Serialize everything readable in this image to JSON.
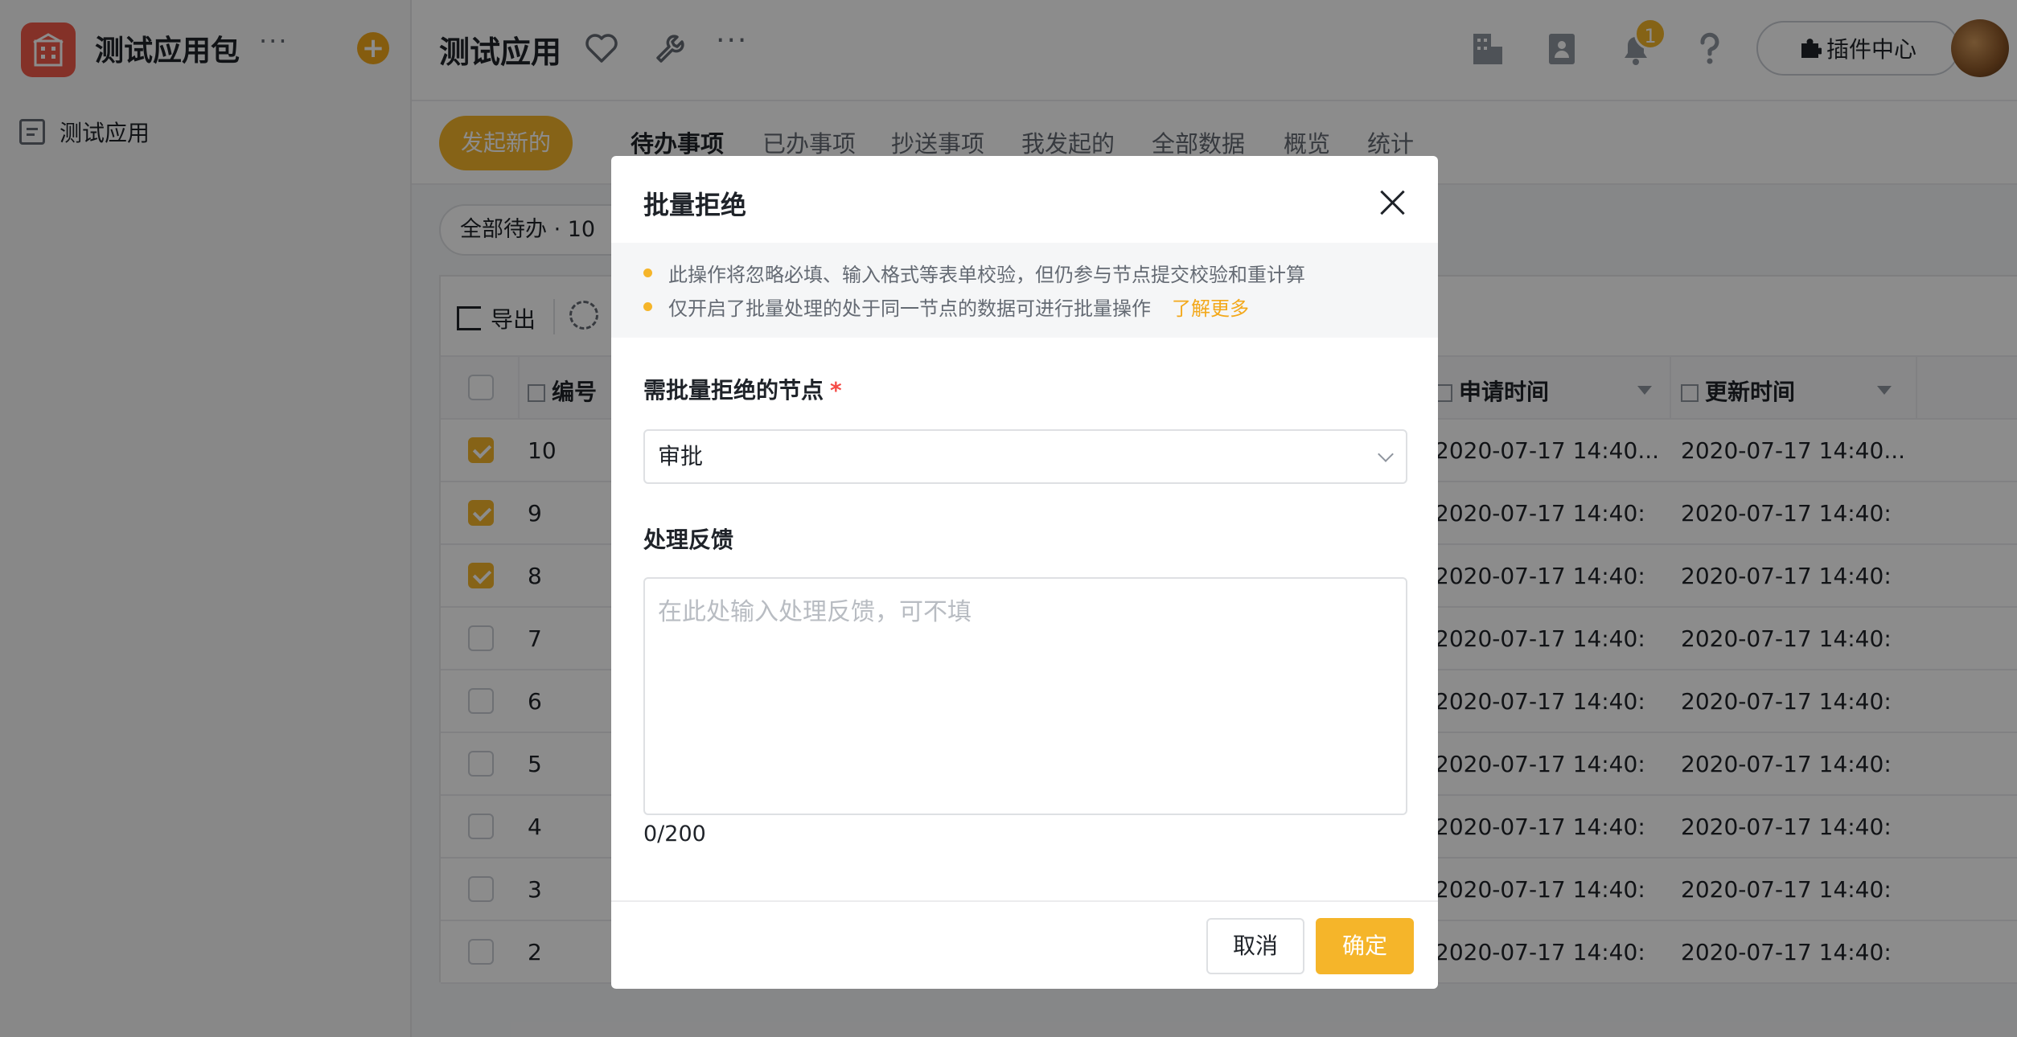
{
  "sidebar": {
    "app_name": "测试应用包",
    "more": "···",
    "add": "+",
    "items": [
      {
        "label": "测试应用"
      }
    ]
  },
  "topbar": {
    "title": "测试应用",
    "more": "···",
    "notification_count": "1",
    "plugin_center": "插件中心"
  },
  "subbar": {
    "new_button": "发起新的",
    "tabs": [
      {
        "label": "待办事项",
        "active": true
      },
      {
        "label": "已办事项"
      },
      {
        "label": "抄送事项"
      },
      {
        "label": "我发起的"
      },
      {
        "label": "全部数据"
      },
      {
        "label": "概览"
      },
      {
        "label": "统计"
      }
    ]
  },
  "content": {
    "filter": "全部待办 · 10",
    "toolbar": {
      "export": "导出"
    },
    "columns": {
      "number": "编号",
      "apply_time": "申请时间",
      "update_time": "更新时间"
    },
    "rows": [
      {
        "id": "10",
        "checked": true,
        "apply": "2020-07-17 14:40...",
        "update": "2020-07-17 14:40..."
      },
      {
        "id": "9",
        "checked": true,
        "apply": "2020-07-17 14:40:",
        "update": "2020-07-17 14:40:"
      },
      {
        "id": "8",
        "checked": true,
        "apply": "2020-07-17 14:40:",
        "update": "2020-07-17 14:40:"
      },
      {
        "id": "7",
        "checked": false,
        "apply": "2020-07-17 14:40:",
        "update": "2020-07-17 14:40:"
      },
      {
        "id": "6",
        "checked": false,
        "apply": "2020-07-17 14:40:",
        "update": "2020-07-17 14:40:"
      },
      {
        "id": "5",
        "checked": false,
        "apply": "2020-07-17 14:40:",
        "update": "2020-07-17 14:40:"
      },
      {
        "id": "4",
        "checked": false,
        "apply": "2020-07-17 14:40:",
        "update": "2020-07-17 14:40:"
      },
      {
        "id": "3",
        "checked": false,
        "apply": "2020-07-17 14:40:",
        "update": "2020-07-17 14:40:"
      },
      {
        "id": "2",
        "checked": false,
        "apply": "2020-07-17 14:40:",
        "update": "2020-07-17 14:40:"
      }
    ]
  },
  "modal": {
    "title": "批量拒绝",
    "notices": [
      "此操作将忽略必填、输入格式等表单校验，但仍参与节点提交校验和重计算",
      "仅开启了批量处理的处于同一节点的数据可进行批量操作"
    ],
    "learn_more": "了解更多",
    "node_label": "需批量拒绝的节点",
    "required_mark": "*",
    "node_value": "审批",
    "feedback_label": "处理反馈",
    "feedback_placeholder": "在此处输入处理反馈，可不填",
    "counter": "0/200",
    "cancel": "取消",
    "confirm": "确定"
  },
  "colors": {
    "accent": "#f5b52a",
    "logo": "#f05a4a",
    "required": "#f54a45"
  }
}
